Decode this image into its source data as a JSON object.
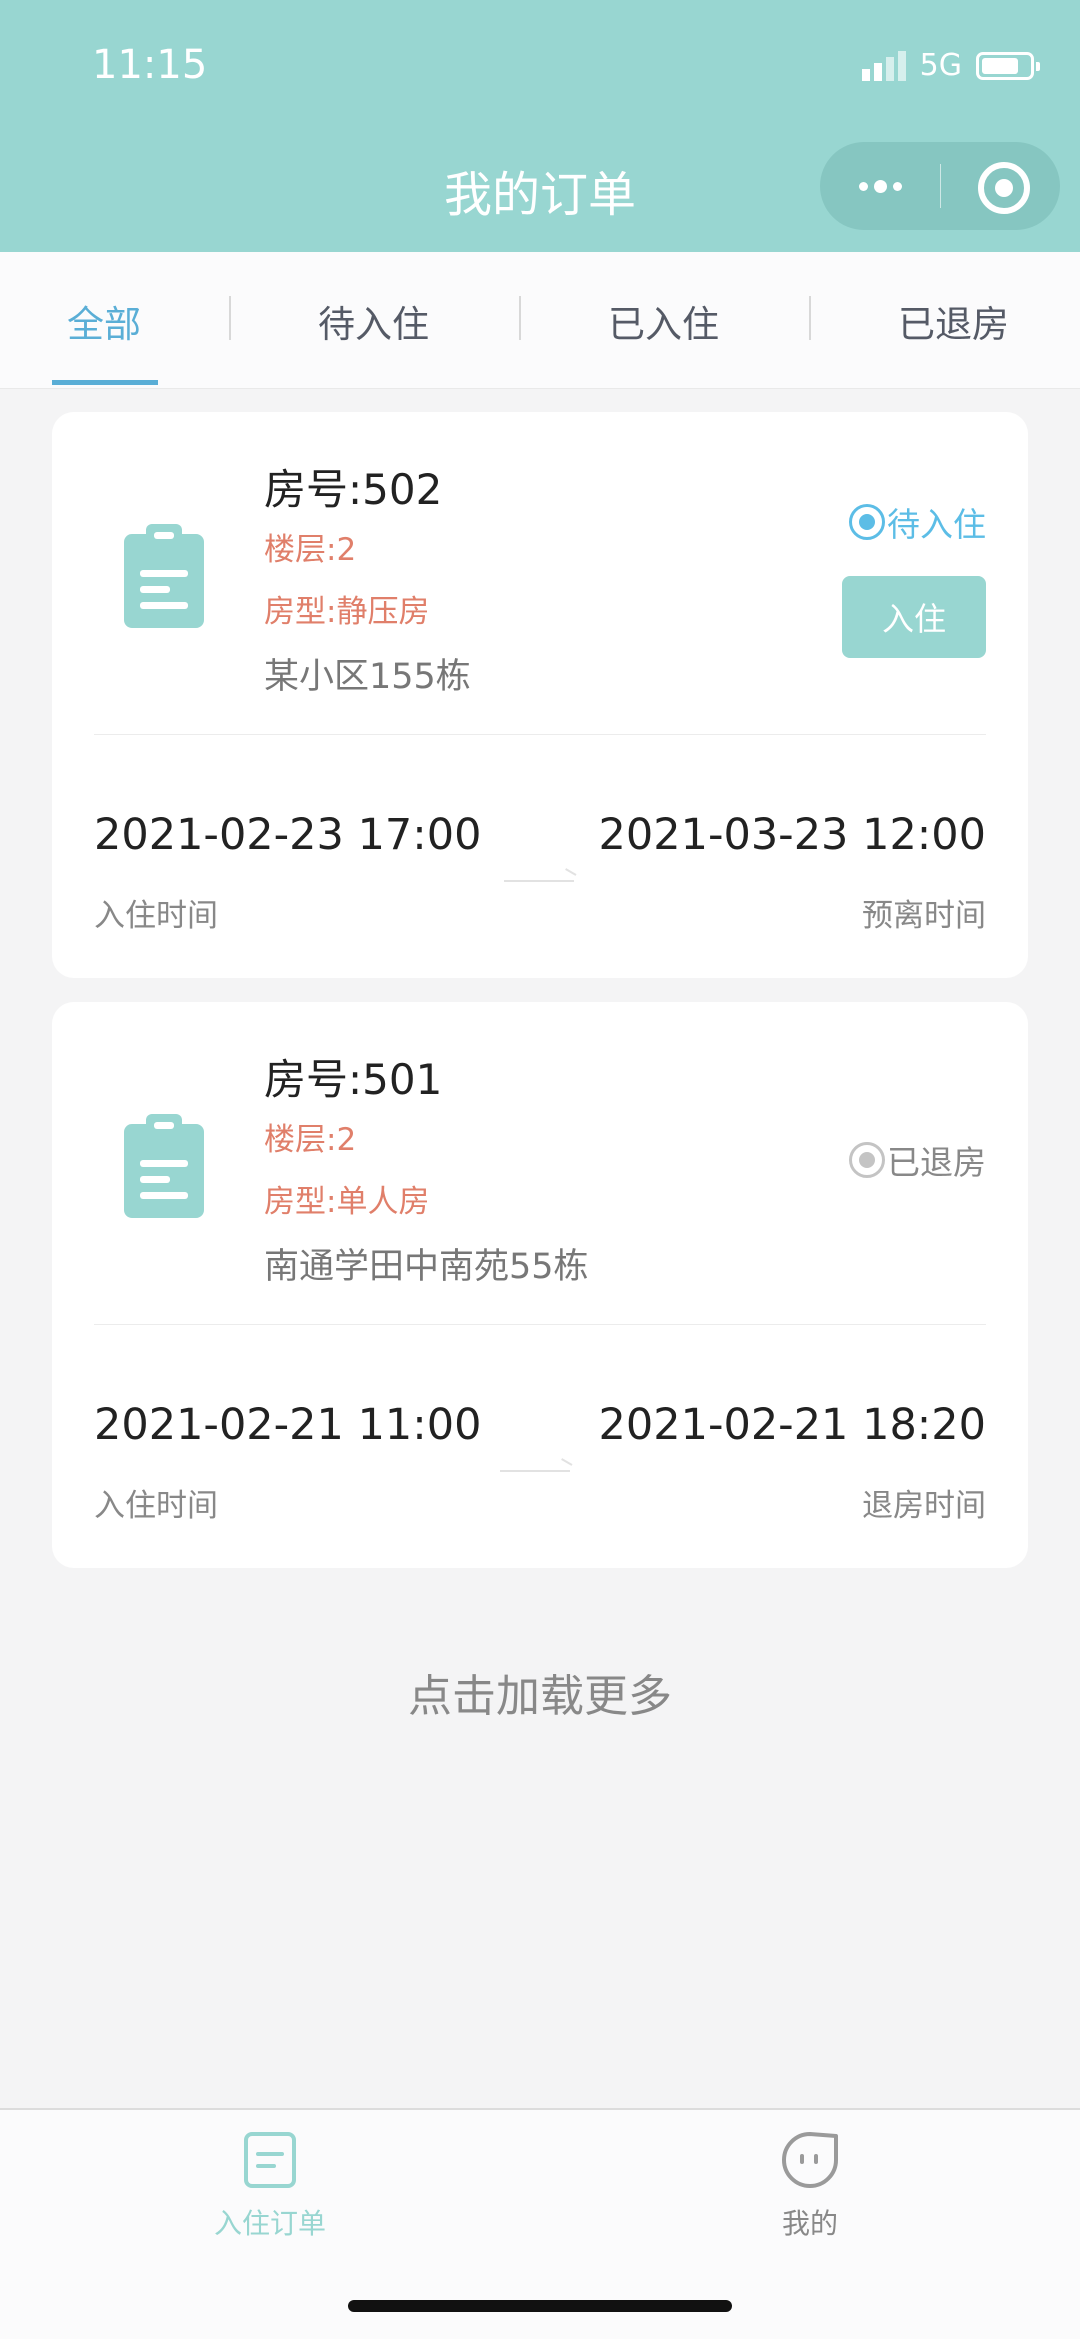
{
  "status_bar": {
    "time": "11:15",
    "network": "5G"
  },
  "header": {
    "title": "我的订单"
  },
  "tabs": [
    {
      "label": "全部"
    },
    {
      "label": "待入住"
    },
    {
      "label": "已入住"
    },
    {
      "label": "已退房"
    }
  ],
  "orders": [
    {
      "room": "房号:502",
      "floor": "楼层:2",
      "type": "房型:静压房",
      "address": "某小区155栋",
      "status": "待入住",
      "action_label": "入住",
      "start_time": "2021-02-23 17:00",
      "start_label": "入住时间",
      "end_time": "2021-03-23 12:00",
      "end_label": "预离时间"
    },
    {
      "room": "房号:501",
      "floor": "楼层:2",
      "type": "房型:单人房",
      "address": "南通学田中南苑55栋",
      "status": "已退房",
      "start_time": "2021-02-21 11:00",
      "start_label": "入住时间",
      "end_time": "2021-02-21 18:20",
      "end_label": "退房时间"
    }
  ],
  "load_more": "点击加载更多",
  "tabbar": [
    {
      "label": "入住订单"
    },
    {
      "label": "我的"
    }
  ],
  "colors": {
    "accent": "#98d6d1",
    "tab_active": "#5aaed6",
    "status_blue": "#5cbde6",
    "highlight_red": "#e07f6a"
  }
}
